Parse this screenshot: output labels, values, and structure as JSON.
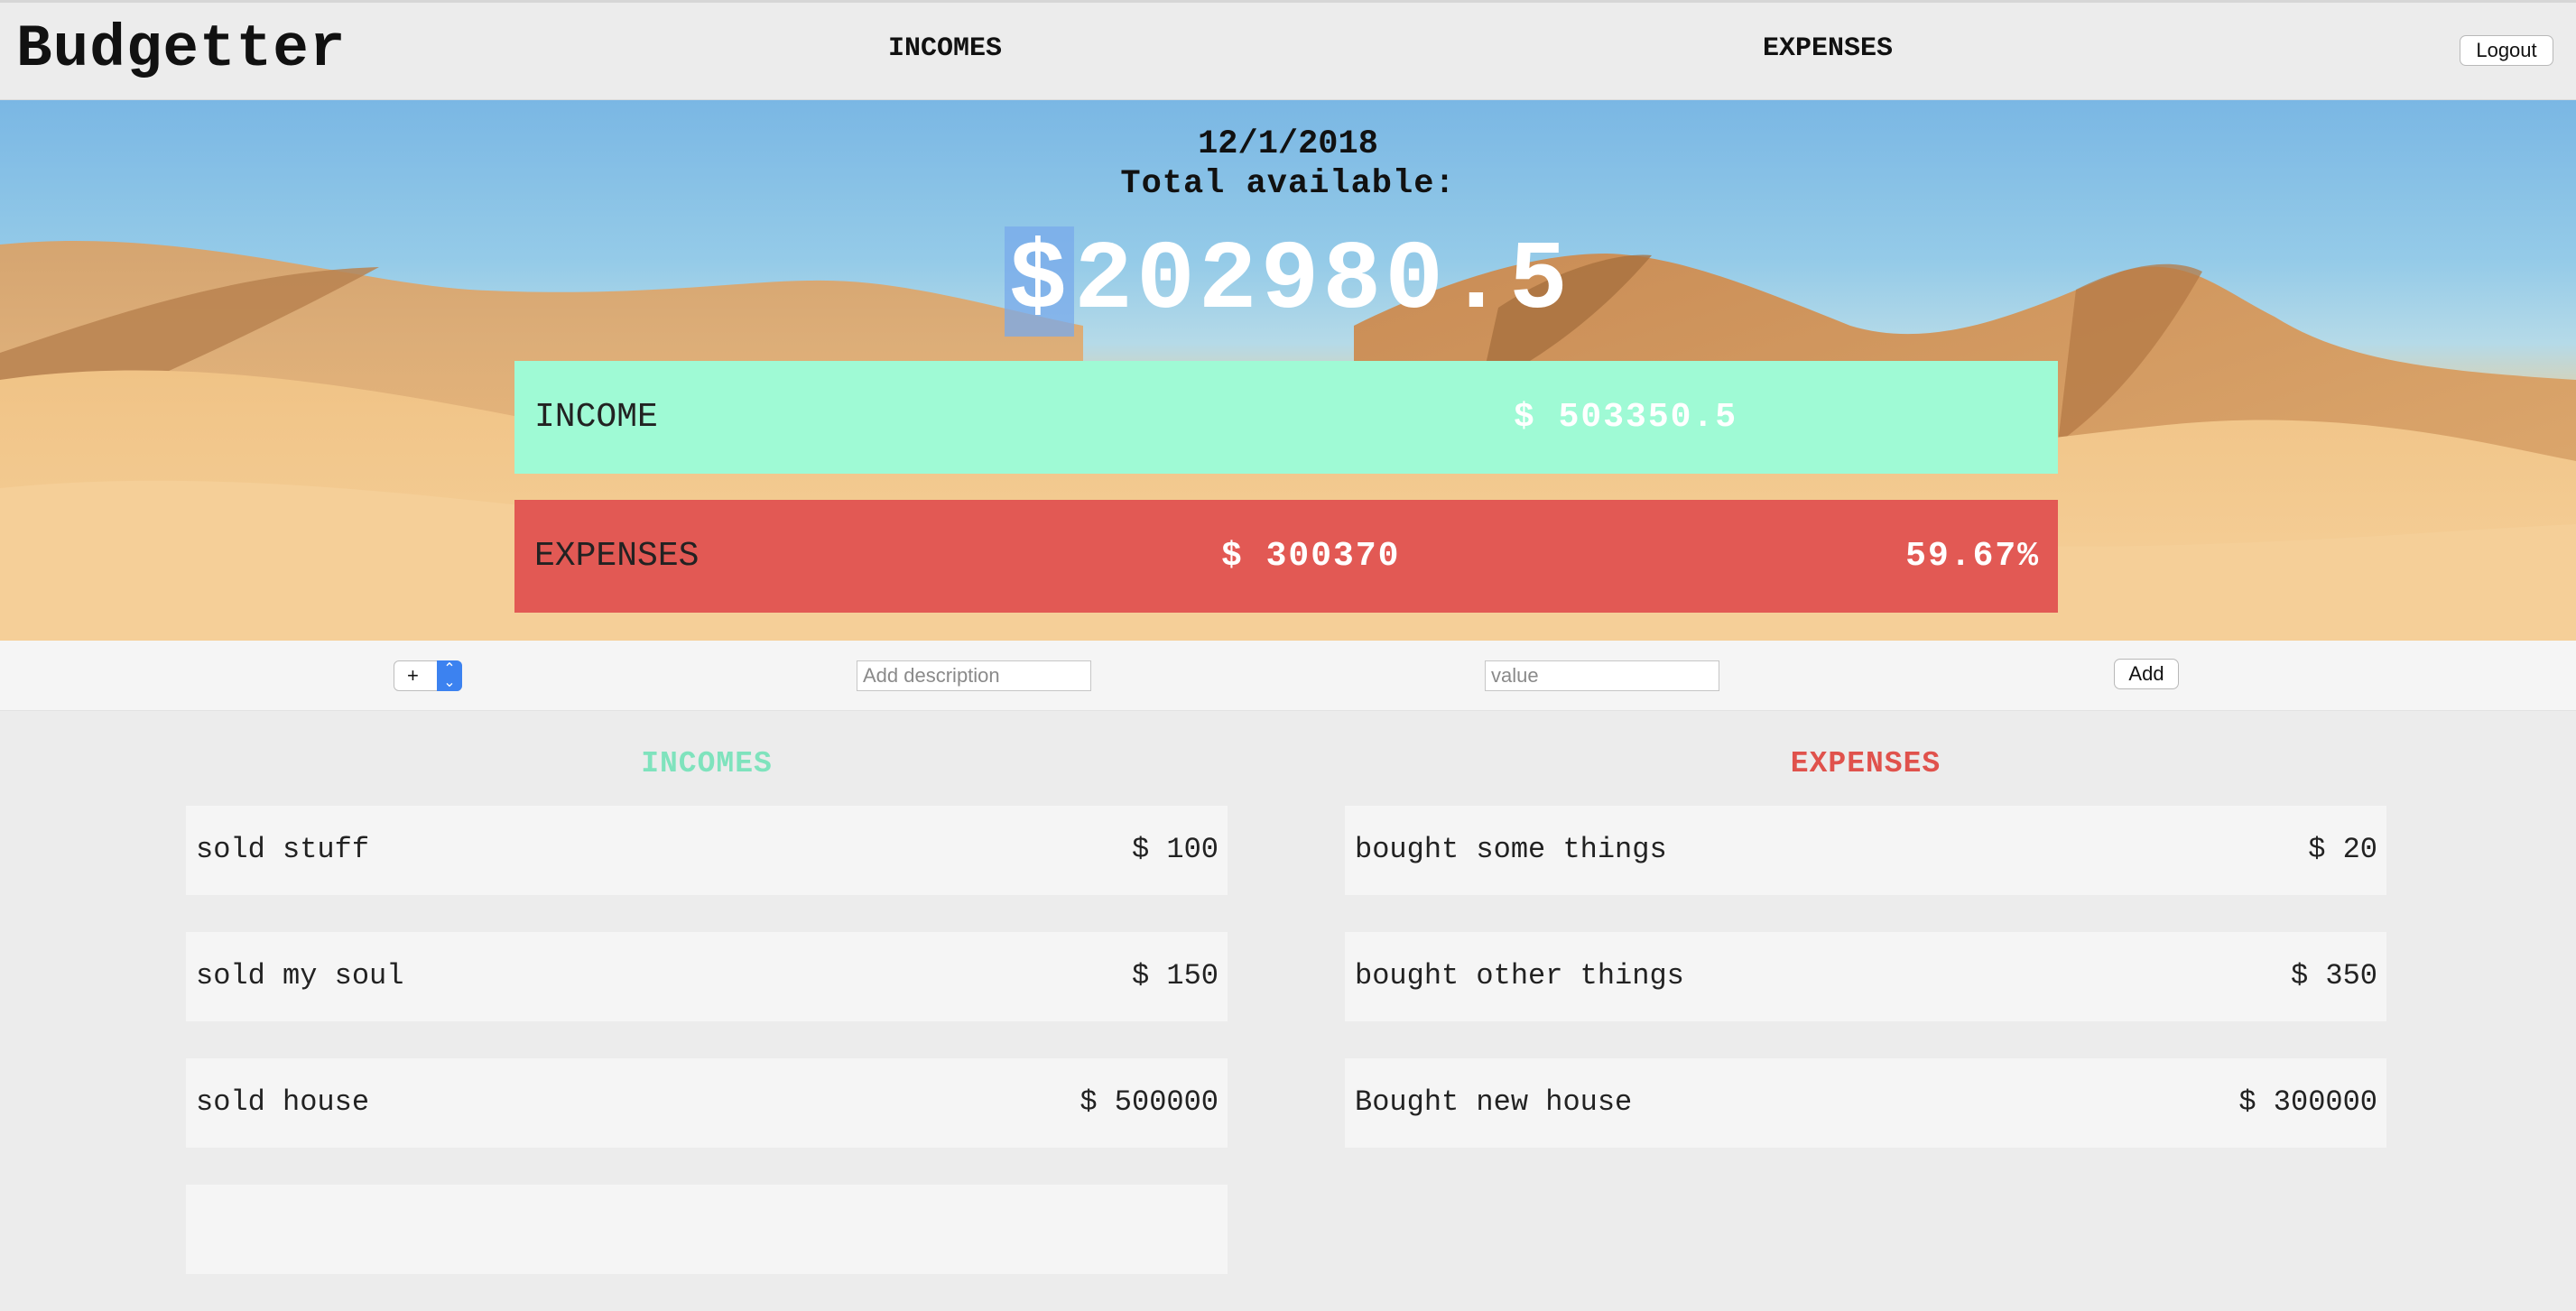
{
  "nav": {
    "brand": "Budgetter",
    "incomes_link": "INCOMES",
    "expenses_link": "EXPENSES",
    "logout_label": "Logout"
  },
  "hero": {
    "date": "12/1/2018",
    "total_label": "Total available:",
    "total_currency": "$",
    "total_value": "202980.5",
    "income_bar": {
      "label": "INCOME",
      "amount": "$ 503350.5"
    },
    "expense_bar": {
      "label": "EXPENSES",
      "amount": "$ 300370",
      "percent": "59.67%"
    }
  },
  "add_form": {
    "type_value": "+",
    "description_placeholder": "Add description",
    "value_placeholder": "value",
    "add_label": "Add"
  },
  "incomes": {
    "title": "INCOMES",
    "items": [
      {
        "description": "sold stuff",
        "amount": "$ 100"
      },
      {
        "description": "sold my soul",
        "amount": "$ 150"
      },
      {
        "description": "sold house",
        "amount": "$ 500000"
      },
      {
        "description": "",
        "amount": ""
      }
    ]
  },
  "expenses": {
    "title": "EXPENSES",
    "items": [
      {
        "description": "bought some things",
        "amount": "$ 20"
      },
      {
        "description": "bought other things",
        "amount": "$ 350"
      },
      {
        "description": "Bought new house",
        "amount": "$ 300000"
      }
    ]
  },
  "colors": {
    "income_accent": "#9ffad5",
    "income_title": "#7fe3bd",
    "expense_accent": "#e25954",
    "expense_title": "#e0524c",
    "select_accent": "#3c82f0"
  },
  "icons": {
    "select_arrows": "updown-chevron-icon"
  }
}
